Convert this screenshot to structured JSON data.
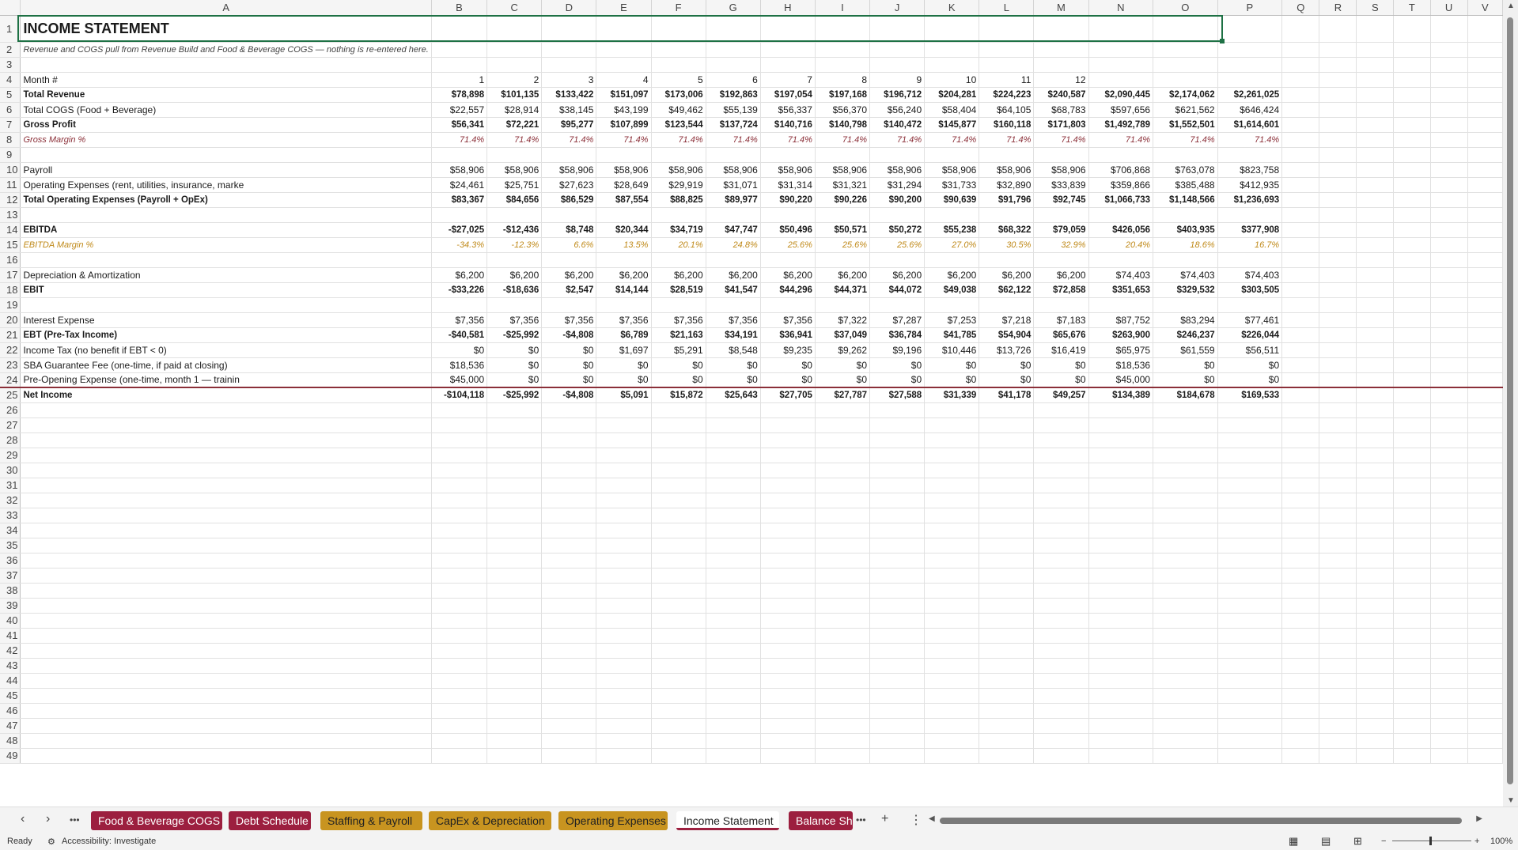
{
  "columns": [
    "A",
    "B",
    "C",
    "D",
    "E",
    "F",
    "G",
    "H",
    "I",
    "J",
    "K",
    "L",
    "M",
    "N",
    "O",
    "P",
    "Q",
    "R",
    "S",
    "T",
    "U",
    "V"
  ],
  "title": "INCOME STATEMENT",
  "subtitle": "Revenue and COGS pull from Revenue Build and Food & Beverage COGS — nothing is re-entered here.",
  "row_numbers": [
    "1",
    "2",
    "3",
    "4",
    "5",
    "6",
    "7",
    "8",
    "9",
    "10",
    "11",
    "12",
    "13",
    "14",
    "15",
    "16",
    "17",
    "18",
    "19",
    "20",
    "21",
    "22",
    "23",
    "24",
    "25",
    "26",
    "27",
    "28",
    "29",
    "30",
    "31",
    "32",
    "33",
    "34",
    "35",
    "36",
    "37",
    "38",
    "39",
    "40",
    "41",
    "42",
    "43",
    "44",
    "45",
    "46",
    "47",
    "48",
    "49"
  ],
  "data_rows": [
    {
      "row": 4,
      "label": "Month #",
      "style": "normal",
      "values": [
        "1",
        "2",
        "3",
        "4",
        "5",
        "6",
        "7",
        "8",
        "9",
        "10",
        "11",
        "12",
        "",
        "",
        ""
      ]
    },
    {
      "row": 5,
      "label": "Total Revenue",
      "style": "bold",
      "values": [
        "$78,898",
        "$101,135",
        "$133,422",
        "$151,097",
        "$173,006",
        "$192,863",
        "$197,054",
        "$197,168",
        "$196,712",
        "$204,281",
        "$224,223",
        "$240,587",
        "$2,090,445",
        "$2,174,062",
        "$2,261,025"
      ]
    },
    {
      "row": 6,
      "label": "Total COGS (Food + Beverage)",
      "style": "normal",
      "values": [
        "$22,557",
        "$28,914",
        "$38,145",
        "$43,199",
        "$49,462",
        "$55,139",
        "$56,337",
        "$56,370",
        "$56,240",
        "$58,404",
        "$64,105",
        "$68,783",
        "$597,656",
        "$621,562",
        "$646,424"
      ]
    },
    {
      "row": 7,
      "label": "Gross Profit",
      "style": "bold",
      "values": [
        "$56,341",
        "$72,221",
        "$95,277",
        "$107,899",
        "$123,544",
        "$137,724",
        "$140,716",
        "$140,798",
        "$140,472",
        "$145,877",
        "$160,118",
        "$171,803",
        "$1,492,789",
        "$1,552,501",
        "$1,614,601"
      ]
    },
    {
      "row": 8,
      "label": "Gross Margin %",
      "style": "gm",
      "values": [
        "71.4%",
        "71.4%",
        "71.4%",
        "71.4%",
        "71.4%",
        "71.4%",
        "71.4%",
        "71.4%",
        "71.4%",
        "71.4%",
        "71.4%",
        "71.4%",
        "71.4%",
        "71.4%",
        "71.4%"
      ]
    },
    {
      "row": 10,
      "label": "Payroll",
      "style": "normal",
      "values": [
        "$58,906",
        "$58,906",
        "$58,906",
        "$58,906",
        "$58,906",
        "$58,906",
        "$58,906",
        "$58,906",
        "$58,906",
        "$58,906",
        "$58,906",
        "$58,906",
        "$706,868",
        "$763,078",
        "$823,758"
      ]
    },
    {
      "row": 11,
      "label": "Operating Expenses (rent, utilities, insurance, marke",
      "style": "normal",
      "values": [
        "$24,461",
        "$25,751",
        "$27,623",
        "$28,649",
        "$29,919",
        "$31,071",
        "$31,314",
        "$31,321",
        "$31,294",
        "$31,733",
        "$32,890",
        "$33,839",
        "$359,866",
        "$385,488",
        "$412,935"
      ]
    },
    {
      "row": 12,
      "label": "Total Operating Expenses (Payroll + OpEx)",
      "style": "bold",
      "values": [
        "$83,367",
        "$84,656",
        "$86,529",
        "$87,554",
        "$88,825",
        "$89,977",
        "$90,220",
        "$90,226",
        "$90,200",
        "$90,639",
        "$91,796",
        "$92,745",
        "$1,066,733",
        "$1,148,566",
        "$1,236,693"
      ]
    },
    {
      "row": 14,
      "label": "EBITDA",
      "style": "bold",
      "values": [
        "-$27,025",
        "-$12,436",
        "$8,748",
        "$20,344",
        "$34,719",
        "$47,747",
        "$50,496",
        "$50,571",
        "$50,272",
        "$55,238",
        "$68,322",
        "$79,059",
        "$426,056",
        "$403,935",
        "$377,908"
      ]
    },
    {
      "row": 15,
      "label": "EBITDA Margin %",
      "style": "em",
      "values": [
        "-34.3%",
        "-12.3%",
        "6.6%",
        "13.5%",
        "20.1%",
        "24.8%",
        "25.6%",
        "25.6%",
        "25.6%",
        "27.0%",
        "30.5%",
        "32.9%",
        "20.4%",
        "18.6%",
        "16.7%"
      ]
    },
    {
      "row": 17,
      "label": "Depreciation & Amortization",
      "style": "normal",
      "values": [
        "$6,200",
        "$6,200",
        "$6,200",
        "$6,200",
        "$6,200",
        "$6,200",
        "$6,200",
        "$6,200",
        "$6,200",
        "$6,200",
        "$6,200",
        "$6,200",
        "$74,403",
        "$74,403",
        "$74,403"
      ]
    },
    {
      "row": 18,
      "label": "EBIT",
      "style": "bold",
      "values": [
        "-$33,226",
        "-$18,636",
        "$2,547",
        "$14,144",
        "$28,519",
        "$41,547",
        "$44,296",
        "$44,371",
        "$44,072",
        "$49,038",
        "$62,122",
        "$72,858",
        "$351,653",
        "$329,532",
        "$303,505"
      ]
    },
    {
      "row": 20,
      "label": "Interest Expense",
      "style": "normal",
      "values": [
        "$7,356",
        "$7,356",
        "$7,356",
        "$7,356",
        "$7,356",
        "$7,356",
        "$7,356",
        "$7,322",
        "$7,287",
        "$7,253",
        "$7,218",
        "$7,183",
        "$87,752",
        "$83,294",
        "$77,461"
      ]
    },
    {
      "row": 21,
      "label": "EBT (Pre-Tax Income)",
      "style": "bold",
      "values": [
        "-$40,581",
        "-$25,992",
        "-$4,808",
        "$6,789",
        "$21,163",
        "$34,191",
        "$36,941",
        "$37,049",
        "$36,784",
        "$41,785",
        "$54,904",
        "$65,676",
        "$263,900",
        "$246,237",
        "$226,044"
      ]
    },
    {
      "row": 22,
      "label": "Income Tax (no benefit if EBT < 0)",
      "style": "normal",
      "values": [
        "$0",
        "$0",
        "$0",
        "$1,697",
        "$5,291",
        "$8,548",
        "$9,235",
        "$9,262",
        "$9,196",
        "$10,446",
        "$13,726",
        "$16,419",
        "$65,975",
        "$61,559",
        "$56,511"
      ]
    },
    {
      "row": 23,
      "label": "SBA Guarantee Fee (one-time, if paid at closing)",
      "style": "normal",
      "values": [
        "$18,536",
        "$0",
        "$0",
        "$0",
        "$0",
        "$0",
        "$0",
        "$0",
        "$0",
        "$0",
        "$0",
        "$0",
        "$18,536",
        "$0",
        "$0"
      ]
    },
    {
      "row": 24,
      "label": "Pre-Opening Expense (one-time, month 1 — trainin",
      "style": "normal",
      "values": [
        "$45,000",
        "$0",
        "$0",
        "$0",
        "$0",
        "$0",
        "$0",
        "$0",
        "$0",
        "$0",
        "$0",
        "$0",
        "$45,000",
        "$0",
        "$0"
      ]
    },
    {
      "row": 25,
      "label": "Net Income",
      "style": "bold",
      "values": [
        "-$104,118",
        "-$25,992",
        "-$4,808",
        "$5,091",
        "$15,872",
        "$25,643",
        "$27,705",
        "$27,787",
        "$27,588",
        "$31,339",
        "$41,178",
        "$49,257",
        "$134,389",
        "$184,678",
        "$169,533"
      ]
    }
  ],
  "tabs": [
    {
      "label": "Food & Beverage COGS",
      "color": "crimson"
    },
    {
      "label": "Debt Schedule",
      "color": "crimson"
    },
    {
      "label": "Staffing & Payroll",
      "color": "gold"
    },
    {
      "label": "CapEx & Depreciation",
      "color": "gold"
    },
    {
      "label": "Operating Expenses",
      "color": "gold"
    },
    {
      "label": "Income Statement",
      "color": "active"
    },
    {
      "label": "Balance Sh",
      "color": "crimson"
    }
  ],
  "tab_more": "•••",
  "tab_add": "+",
  "tab_menu": "⋮",
  "status": {
    "ready": "Ready",
    "accessibility": "Accessibility: Investigate",
    "zoom": "100%"
  },
  "colors": {
    "crimson": "#9c1f3f",
    "gold": "#c89420",
    "selection": "#1e7145",
    "margin_text": "#8b2f38",
    "ebitda_text": "#c08a1a"
  }
}
